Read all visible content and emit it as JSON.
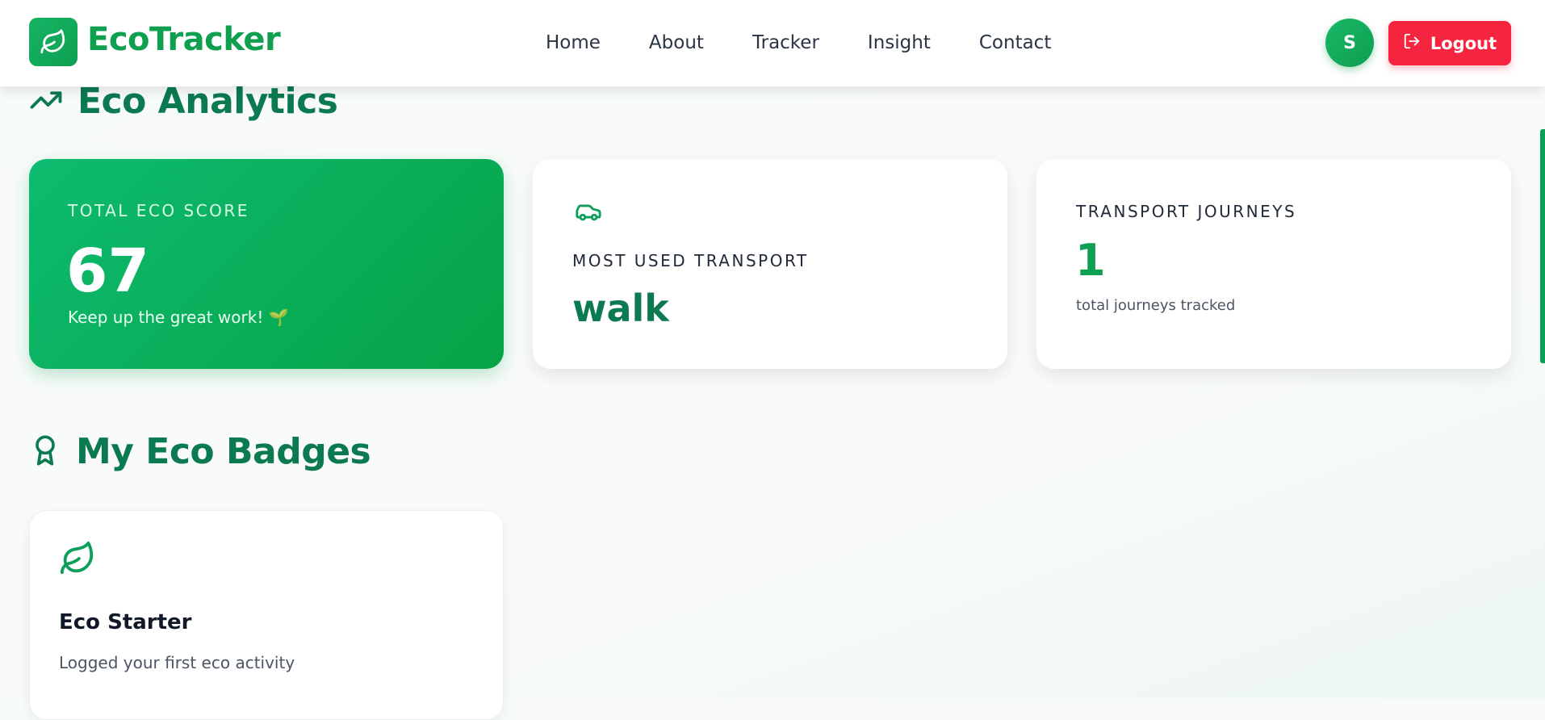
{
  "brand": {
    "name": "EcoTracker"
  },
  "nav": {
    "home": "Home",
    "about": "About",
    "tracker": "Tracker",
    "insight": "Insight",
    "contact": "Contact"
  },
  "user": {
    "initial": "S",
    "logout_label": "Logout"
  },
  "analytics": {
    "title": "Eco Analytics",
    "score": {
      "label": "TOTAL ECO SCORE",
      "value": "67",
      "subtitle": "Keep up the great work! 🌱"
    },
    "transport": {
      "label": "MOST USED TRANSPORT",
      "value": "walk"
    },
    "journeys": {
      "label": "TRANSPORT JOURNEYS",
      "value": "1",
      "subtitle": "total journeys tracked"
    }
  },
  "badges": {
    "title": "My Eco Badges",
    "items": [
      {
        "title": "Eco Starter",
        "description": "Logged your first eco activity"
      }
    ]
  },
  "colors": {
    "brand_green": "#0e9f4f",
    "heading_green": "#0b7a50",
    "logout_red": "#f5243f"
  }
}
